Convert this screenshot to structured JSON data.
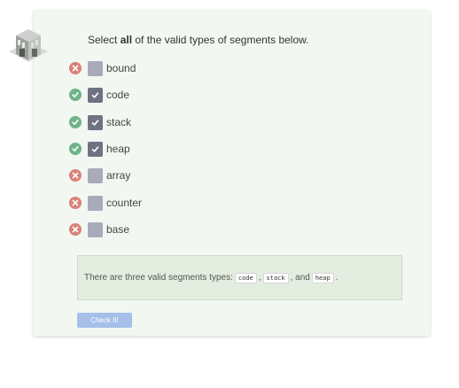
{
  "question": {
    "prefix": "Select ",
    "emphasis": "all",
    "suffix": " of the valid types of segments below."
  },
  "options": [
    {
      "label": "bound",
      "checked": false,
      "result": "incorrect",
      "result_icon": "x-icon"
    },
    {
      "label": "code",
      "checked": true,
      "result": "correct",
      "result_icon": "check-icon"
    },
    {
      "label": "stack",
      "checked": true,
      "result": "correct",
      "result_icon": "check-icon"
    },
    {
      "label": "heap",
      "checked": true,
      "result": "correct",
      "result_icon": "check-icon"
    },
    {
      "label": "array",
      "checked": false,
      "result": "incorrect",
      "result_icon": "x-icon"
    },
    {
      "label": "counter",
      "checked": false,
      "result": "incorrect",
      "result_icon": "x-icon"
    },
    {
      "label": "base",
      "checked": false,
      "result": "incorrect",
      "result_icon": "x-icon"
    }
  ],
  "feedback": {
    "text_before": "There are three valid segments types: ",
    "code1": "code",
    "sep1": ", ",
    "code2": "stack",
    "sep2": ", and ",
    "code3": "heap",
    "text_after": "."
  },
  "button": {
    "label": "Check It!"
  },
  "colors": {
    "card_background": "#f3f7f2",
    "correct": "#6fb38a",
    "incorrect": "#d9817b",
    "checkbox_checked": "#6f7283",
    "checkbox_unchecked": "#a9abbb",
    "feedback_background": "#e3eee0",
    "button": "#a6bfe8"
  },
  "icons": {
    "logo": "building-logo-icon"
  }
}
